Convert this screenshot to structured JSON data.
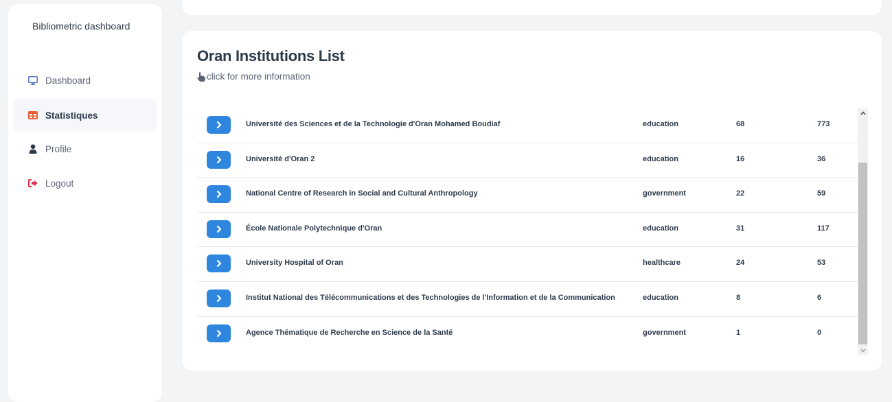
{
  "sidebar": {
    "brand": "Bibliometric dashboard",
    "items": [
      {
        "label": "Dashboard",
        "icon": "monitor-icon"
      },
      {
        "label": "Statistiques",
        "icon": "table-icon",
        "active": true
      },
      {
        "label": "Profile",
        "icon": "user-icon"
      },
      {
        "label": "Logout",
        "icon": "logout-icon"
      }
    ]
  },
  "main": {
    "title": "Oran Institutions List",
    "subtitle": "click for more information",
    "rows": [
      {
        "name": "Université des Sciences et de la Technologie d'Oran Mohamed Boudiaf",
        "type": "education",
        "n1": "68",
        "n2": "773"
      },
      {
        "name": "Université d'Oran 2",
        "type": "education",
        "n1": "16",
        "n2": "36"
      },
      {
        "name": "National Centre of Research in Social and Cultural Anthropology",
        "type": "government",
        "n1": "22",
        "n2": "59"
      },
      {
        "name": "École Nationale Polytechnique d'Oran",
        "type": "education",
        "n1": "31",
        "n2": "117"
      },
      {
        "name": "University Hospital of Oran",
        "type": "healthcare",
        "n1": "24",
        "n2": "53"
      },
      {
        "name": "Institut National des Télécommunications et des Technologies de l'Information et de la Communication",
        "type": "education",
        "n1": "8",
        "n2": "6"
      },
      {
        "name": "Agence Thématique de Recherche en Science de la Santé",
        "type": "government",
        "n1": "1",
        "n2": "0"
      }
    ]
  },
  "colors": {
    "accent": "#2f86de",
    "logout": "#e0304e",
    "table_icon": "#e8603c",
    "monitor_icon": "#5b78c7"
  }
}
